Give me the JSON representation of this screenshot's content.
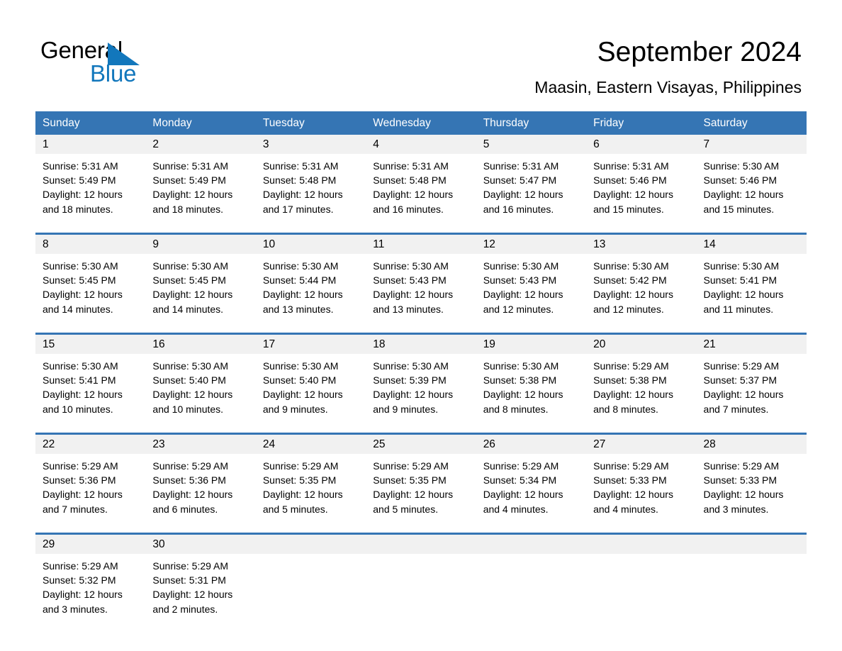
{
  "brand": {
    "name_part1": "General",
    "name_part2": "Blue",
    "triangle_color": "#1277bc"
  },
  "header": {
    "title": "September 2024",
    "subtitle": "Maasin, Eastern Visayas, Philippines"
  },
  "colors": {
    "header_blue": "#3575b4",
    "row_rule_blue": "#3575b4",
    "daynum_band": "#f1f1f1",
    "brand_blue": "#1277bc",
    "text": "#000000"
  },
  "weekday_headers": [
    "Sunday",
    "Monday",
    "Tuesday",
    "Wednesday",
    "Thursday",
    "Friday",
    "Saturday"
  ],
  "weeks": [
    [
      {
        "day": "1",
        "sunrise": "Sunrise: 5:31 AM",
        "sunset": "Sunset: 5:49 PM",
        "daylight_line1": "Daylight: 12 hours",
        "daylight_line2": "and 18 minutes."
      },
      {
        "day": "2",
        "sunrise": "Sunrise: 5:31 AM",
        "sunset": "Sunset: 5:49 PM",
        "daylight_line1": "Daylight: 12 hours",
        "daylight_line2": "and 18 minutes."
      },
      {
        "day": "3",
        "sunrise": "Sunrise: 5:31 AM",
        "sunset": "Sunset: 5:48 PM",
        "daylight_line1": "Daylight: 12 hours",
        "daylight_line2": "and 17 minutes."
      },
      {
        "day": "4",
        "sunrise": "Sunrise: 5:31 AM",
        "sunset": "Sunset: 5:48 PM",
        "daylight_line1": "Daylight: 12 hours",
        "daylight_line2": "and 16 minutes."
      },
      {
        "day": "5",
        "sunrise": "Sunrise: 5:31 AM",
        "sunset": "Sunset: 5:47 PM",
        "daylight_line1": "Daylight: 12 hours",
        "daylight_line2": "and 16 minutes."
      },
      {
        "day": "6",
        "sunrise": "Sunrise: 5:31 AM",
        "sunset": "Sunset: 5:46 PM",
        "daylight_line1": "Daylight: 12 hours",
        "daylight_line2": "and 15 minutes."
      },
      {
        "day": "7",
        "sunrise": "Sunrise: 5:30 AM",
        "sunset": "Sunset: 5:46 PM",
        "daylight_line1": "Daylight: 12 hours",
        "daylight_line2": "and 15 minutes."
      }
    ],
    [
      {
        "day": "8",
        "sunrise": "Sunrise: 5:30 AM",
        "sunset": "Sunset: 5:45 PM",
        "daylight_line1": "Daylight: 12 hours",
        "daylight_line2": "and 14 minutes."
      },
      {
        "day": "9",
        "sunrise": "Sunrise: 5:30 AM",
        "sunset": "Sunset: 5:45 PM",
        "daylight_line1": "Daylight: 12 hours",
        "daylight_line2": "and 14 minutes."
      },
      {
        "day": "10",
        "sunrise": "Sunrise: 5:30 AM",
        "sunset": "Sunset: 5:44 PM",
        "daylight_line1": "Daylight: 12 hours",
        "daylight_line2": "and 13 minutes."
      },
      {
        "day": "11",
        "sunrise": "Sunrise: 5:30 AM",
        "sunset": "Sunset: 5:43 PM",
        "daylight_line1": "Daylight: 12 hours",
        "daylight_line2": "and 13 minutes."
      },
      {
        "day": "12",
        "sunrise": "Sunrise: 5:30 AM",
        "sunset": "Sunset: 5:43 PM",
        "daylight_line1": "Daylight: 12 hours",
        "daylight_line2": "and 12 minutes."
      },
      {
        "day": "13",
        "sunrise": "Sunrise: 5:30 AM",
        "sunset": "Sunset: 5:42 PM",
        "daylight_line1": "Daylight: 12 hours",
        "daylight_line2": "and 12 minutes."
      },
      {
        "day": "14",
        "sunrise": "Sunrise: 5:30 AM",
        "sunset": "Sunset: 5:41 PM",
        "daylight_line1": "Daylight: 12 hours",
        "daylight_line2": "and 11 minutes."
      }
    ],
    [
      {
        "day": "15",
        "sunrise": "Sunrise: 5:30 AM",
        "sunset": "Sunset: 5:41 PM",
        "daylight_line1": "Daylight: 12 hours",
        "daylight_line2": "and 10 minutes."
      },
      {
        "day": "16",
        "sunrise": "Sunrise: 5:30 AM",
        "sunset": "Sunset: 5:40 PM",
        "daylight_line1": "Daylight: 12 hours",
        "daylight_line2": "and 10 minutes."
      },
      {
        "day": "17",
        "sunrise": "Sunrise: 5:30 AM",
        "sunset": "Sunset: 5:40 PM",
        "daylight_line1": "Daylight: 12 hours",
        "daylight_line2": "and 9 minutes."
      },
      {
        "day": "18",
        "sunrise": "Sunrise: 5:30 AM",
        "sunset": "Sunset: 5:39 PM",
        "daylight_line1": "Daylight: 12 hours",
        "daylight_line2": "and 9 minutes."
      },
      {
        "day": "19",
        "sunrise": "Sunrise: 5:30 AM",
        "sunset": "Sunset: 5:38 PM",
        "daylight_line1": "Daylight: 12 hours",
        "daylight_line2": "and 8 minutes."
      },
      {
        "day": "20",
        "sunrise": "Sunrise: 5:29 AM",
        "sunset": "Sunset: 5:38 PM",
        "daylight_line1": "Daylight: 12 hours",
        "daylight_line2": "and 8 minutes."
      },
      {
        "day": "21",
        "sunrise": "Sunrise: 5:29 AM",
        "sunset": "Sunset: 5:37 PM",
        "daylight_line1": "Daylight: 12 hours",
        "daylight_line2": "and 7 minutes."
      }
    ],
    [
      {
        "day": "22",
        "sunrise": "Sunrise: 5:29 AM",
        "sunset": "Sunset: 5:36 PM",
        "daylight_line1": "Daylight: 12 hours",
        "daylight_line2": "and 7 minutes."
      },
      {
        "day": "23",
        "sunrise": "Sunrise: 5:29 AM",
        "sunset": "Sunset: 5:36 PM",
        "daylight_line1": "Daylight: 12 hours",
        "daylight_line2": "and 6 minutes."
      },
      {
        "day": "24",
        "sunrise": "Sunrise: 5:29 AM",
        "sunset": "Sunset: 5:35 PM",
        "daylight_line1": "Daylight: 12 hours",
        "daylight_line2": "and 5 minutes."
      },
      {
        "day": "25",
        "sunrise": "Sunrise: 5:29 AM",
        "sunset": "Sunset: 5:35 PM",
        "daylight_line1": "Daylight: 12 hours",
        "daylight_line2": "and 5 minutes."
      },
      {
        "day": "26",
        "sunrise": "Sunrise: 5:29 AM",
        "sunset": "Sunset: 5:34 PM",
        "daylight_line1": "Daylight: 12 hours",
        "daylight_line2": "and 4 minutes."
      },
      {
        "day": "27",
        "sunrise": "Sunrise: 5:29 AM",
        "sunset": "Sunset: 5:33 PM",
        "daylight_line1": "Daylight: 12 hours",
        "daylight_line2": "and 4 minutes."
      },
      {
        "day": "28",
        "sunrise": "Sunrise: 5:29 AM",
        "sunset": "Sunset: 5:33 PM",
        "daylight_line1": "Daylight: 12 hours",
        "daylight_line2": "and 3 minutes."
      }
    ],
    [
      {
        "day": "29",
        "sunrise": "Sunrise: 5:29 AM",
        "sunset": "Sunset: 5:32 PM",
        "daylight_line1": "Daylight: 12 hours",
        "daylight_line2": "and 3 minutes."
      },
      {
        "day": "30",
        "sunrise": "Sunrise: 5:29 AM",
        "sunset": "Sunset: 5:31 PM",
        "daylight_line1": "Daylight: 12 hours",
        "daylight_line2": "and 2 minutes."
      },
      {
        "day": "",
        "sunrise": "",
        "sunset": "",
        "daylight_line1": "",
        "daylight_line2": ""
      },
      {
        "day": "",
        "sunrise": "",
        "sunset": "",
        "daylight_line1": "",
        "daylight_line2": ""
      },
      {
        "day": "",
        "sunrise": "",
        "sunset": "",
        "daylight_line1": "",
        "daylight_line2": ""
      },
      {
        "day": "",
        "sunrise": "",
        "sunset": "",
        "daylight_line1": "",
        "daylight_line2": ""
      },
      {
        "day": "",
        "sunrise": "",
        "sunset": "",
        "daylight_line1": "",
        "daylight_line2": ""
      }
    ]
  ]
}
